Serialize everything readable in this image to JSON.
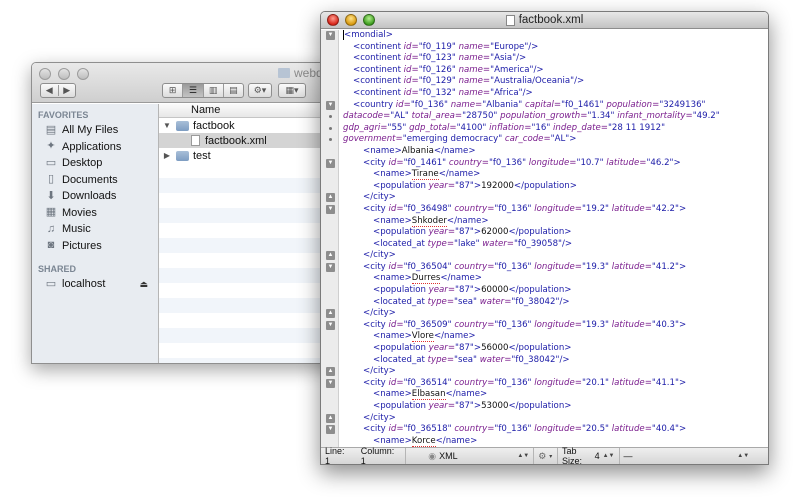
{
  "finder": {
    "title": "webdav",
    "nav": {
      "back": "◀",
      "forward": "▶"
    },
    "view_buttons": [
      "⊞",
      "☰",
      "▥",
      "▤"
    ],
    "action_button": "⚙▾",
    "arrange_button": "▦▾",
    "sidebar": {
      "favorites_header": "FAVORITES",
      "favorites": [
        {
          "label": "All My Files",
          "icon": "all-files-icon"
        },
        {
          "label": "Applications",
          "icon": "applications-icon"
        },
        {
          "label": "Desktop",
          "icon": "desktop-icon"
        },
        {
          "label": "Documents",
          "icon": "documents-icon"
        },
        {
          "label": "Downloads",
          "icon": "downloads-icon"
        },
        {
          "label": "Movies",
          "icon": "movies-icon"
        },
        {
          "label": "Music",
          "icon": "music-icon"
        },
        {
          "label": "Pictures",
          "icon": "pictures-icon"
        }
      ],
      "shared_header": "SHARED",
      "shared": [
        {
          "label": "localhost",
          "icon": "computer-icon"
        }
      ]
    },
    "column_header": "Name",
    "files": [
      {
        "name": "factbook",
        "type": "folder",
        "expanded": true
      },
      {
        "name": "factbook.xml",
        "type": "file",
        "selected": true
      },
      {
        "name": "test",
        "type": "folder",
        "expanded": false
      }
    ]
  },
  "editor": {
    "title": "factbook.xml",
    "lines": [
      {
        "i": 0,
        "parts": [
          [
            "tag",
            "<mondial>"
          ]
        ],
        "cursor": true
      },
      {
        "i": 1,
        "parts": [
          [
            "tag",
            "<continent "
          ],
          [
            "attr",
            "id="
          ],
          [
            "val",
            "\"f0_119\" "
          ],
          [
            "attr",
            "name="
          ],
          [
            "val",
            "\"Europe\""
          ],
          [
            "tag",
            "/>"
          ]
        ]
      },
      {
        "i": 1,
        "parts": [
          [
            "tag",
            "<continent "
          ],
          [
            "attr",
            "id="
          ],
          [
            "val",
            "\"f0_123\" "
          ],
          [
            "attr",
            "name="
          ],
          [
            "val",
            "\"Asia\""
          ],
          [
            "tag",
            "/>"
          ]
        ]
      },
      {
        "i": 1,
        "parts": [
          [
            "tag",
            "<continent "
          ],
          [
            "attr",
            "id="
          ],
          [
            "val",
            "\"f0_126\" "
          ],
          [
            "attr",
            "name="
          ],
          [
            "val",
            "\"America\""
          ],
          [
            "tag",
            "/>"
          ]
        ]
      },
      {
        "i": 1,
        "parts": [
          [
            "tag",
            "<continent "
          ],
          [
            "attr",
            "id="
          ],
          [
            "val",
            "\"f0_129\" "
          ],
          [
            "attr",
            "name="
          ],
          [
            "val",
            "\"Australia/Oceania\""
          ],
          [
            "tag",
            "/>"
          ]
        ]
      },
      {
        "i": 1,
        "parts": [
          [
            "tag",
            "<continent "
          ],
          [
            "attr",
            "id="
          ],
          [
            "val",
            "\"f0_132\" "
          ],
          [
            "attr",
            "name="
          ],
          [
            "val",
            "\"Africa\""
          ],
          [
            "tag",
            "/>"
          ]
        ]
      },
      {
        "i": 1,
        "parts": [
          [
            "tag",
            "<country "
          ],
          [
            "attr",
            "id="
          ],
          [
            "val",
            "\"f0_136\" "
          ],
          [
            "attr",
            "name="
          ],
          [
            "val",
            "\"Albania\" "
          ],
          [
            "attr",
            "capital="
          ],
          [
            "val",
            "\"f0_1461\" "
          ],
          [
            "attr",
            "population="
          ],
          [
            "val",
            "\"3249136\""
          ]
        ]
      },
      {
        "i": 0,
        "cont": true,
        "parts": [
          [
            "attr",
            "datacode="
          ],
          [
            "val",
            "\"AL\" "
          ],
          [
            "attr",
            "total_area="
          ],
          [
            "val",
            "\"28750\" "
          ],
          [
            "attr",
            "population_growth="
          ],
          [
            "val",
            "\"1.34\" "
          ],
          [
            "attr",
            "infant_mortality="
          ],
          [
            "val",
            "\"49.2\""
          ]
        ]
      },
      {
        "i": 0,
        "cont": true,
        "parts": [
          [
            "attr",
            "gdp_agri="
          ],
          [
            "val",
            "\"55\" "
          ],
          [
            "attr",
            "gdp_total="
          ],
          [
            "val",
            "\"4100\" "
          ],
          [
            "attr",
            "inflation="
          ],
          [
            "val",
            "\"16\" "
          ],
          [
            "attr",
            "indep_date="
          ],
          [
            "val",
            "\"28 11 1912\""
          ]
        ]
      },
      {
        "i": 0,
        "cont": true,
        "parts": [
          [
            "attr",
            "government="
          ],
          [
            "val",
            "\"emerging democracy\" "
          ],
          [
            "attr",
            "car_code="
          ],
          [
            "val",
            "\"AL\""
          ],
          [
            "tag",
            ">"
          ]
        ]
      },
      {
        "i": 2,
        "parts": [
          [
            "tag",
            "<name>"
          ],
          [
            "text",
            "Albania"
          ],
          [
            "tag",
            "</name>"
          ]
        ]
      },
      {
        "i": 2,
        "parts": [
          [
            "tag",
            "<city "
          ],
          [
            "attr",
            "id="
          ],
          [
            "val",
            "\"f0_1461\" "
          ],
          [
            "attr",
            "country="
          ],
          [
            "val",
            "\"f0_136\" "
          ],
          [
            "attr",
            "longitude="
          ],
          [
            "val",
            "\"10.7\" "
          ],
          [
            "attr",
            "latitude="
          ],
          [
            "val",
            "\"46.2\""
          ],
          [
            "tag",
            ">"
          ]
        ]
      },
      {
        "i": 3,
        "parts": [
          [
            "tag",
            "<name>"
          ],
          [
            "spell",
            "Tirane"
          ],
          [
            "tag",
            "</name>"
          ]
        ]
      },
      {
        "i": 3,
        "parts": [
          [
            "tag",
            "<population "
          ],
          [
            "attr",
            "year="
          ],
          [
            "val",
            "\"87\""
          ],
          [
            "tag",
            ">"
          ],
          [
            "text",
            "192000"
          ],
          [
            "tag",
            "</population>"
          ]
        ]
      },
      {
        "i": 2,
        "parts": [
          [
            "tag",
            "</city>"
          ]
        ]
      },
      {
        "i": 2,
        "parts": [
          [
            "tag",
            "<city "
          ],
          [
            "attr",
            "id="
          ],
          [
            "val",
            "\"f0_36498\" "
          ],
          [
            "attr",
            "country="
          ],
          [
            "val",
            "\"f0_136\" "
          ],
          [
            "attr",
            "longitude="
          ],
          [
            "val",
            "\"19.2\" "
          ],
          [
            "attr",
            "latitude="
          ],
          [
            "val",
            "\"42.2\""
          ],
          [
            "tag",
            ">"
          ]
        ]
      },
      {
        "i": 3,
        "parts": [
          [
            "tag",
            "<name>"
          ],
          [
            "spell",
            "Shkoder"
          ],
          [
            "tag",
            "</name>"
          ]
        ]
      },
      {
        "i": 3,
        "parts": [
          [
            "tag",
            "<population "
          ],
          [
            "attr",
            "year="
          ],
          [
            "val",
            "\"87\""
          ],
          [
            "tag",
            ">"
          ],
          [
            "text",
            "62000"
          ],
          [
            "tag",
            "</population>"
          ]
        ]
      },
      {
        "i": 3,
        "parts": [
          [
            "tag",
            "<located_at "
          ],
          [
            "attr",
            "type="
          ],
          [
            "val",
            "\"lake\" "
          ],
          [
            "attr",
            "water="
          ],
          [
            "val",
            "\"f0_39058\""
          ],
          [
            "tag",
            "/>"
          ]
        ]
      },
      {
        "i": 2,
        "parts": [
          [
            "tag",
            "</city>"
          ]
        ]
      },
      {
        "i": 2,
        "parts": [
          [
            "tag",
            "<city "
          ],
          [
            "attr",
            "id="
          ],
          [
            "val",
            "\"f0_36504\" "
          ],
          [
            "attr",
            "country="
          ],
          [
            "val",
            "\"f0_136\" "
          ],
          [
            "attr",
            "longitude="
          ],
          [
            "val",
            "\"19.3\" "
          ],
          [
            "attr",
            "latitude="
          ],
          [
            "val",
            "\"41.2\""
          ],
          [
            "tag",
            ">"
          ]
        ]
      },
      {
        "i": 3,
        "parts": [
          [
            "tag",
            "<name>"
          ],
          [
            "spell",
            "Durres"
          ],
          [
            "tag",
            "</name>"
          ]
        ]
      },
      {
        "i": 3,
        "parts": [
          [
            "tag",
            "<population "
          ],
          [
            "attr",
            "year="
          ],
          [
            "val",
            "\"87\""
          ],
          [
            "tag",
            ">"
          ],
          [
            "text",
            "60000"
          ],
          [
            "tag",
            "</population>"
          ]
        ]
      },
      {
        "i": 3,
        "parts": [
          [
            "tag",
            "<located_at "
          ],
          [
            "attr",
            "type="
          ],
          [
            "val",
            "\"sea\" "
          ],
          [
            "attr",
            "water="
          ],
          [
            "val",
            "\"f0_38042\""
          ],
          [
            "tag",
            "/>"
          ]
        ]
      },
      {
        "i": 2,
        "parts": [
          [
            "tag",
            "</city>"
          ]
        ]
      },
      {
        "i": 2,
        "parts": [
          [
            "tag",
            "<city "
          ],
          [
            "attr",
            "id="
          ],
          [
            "val",
            "\"f0_36509\" "
          ],
          [
            "attr",
            "country="
          ],
          [
            "val",
            "\"f0_136\" "
          ],
          [
            "attr",
            "longitude="
          ],
          [
            "val",
            "\"19.3\" "
          ],
          [
            "attr",
            "latitude="
          ],
          [
            "val",
            "\"40.3\""
          ],
          [
            "tag",
            ">"
          ]
        ]
      },
      {
        "i": 3,
        "parts": [
          [
            "tag",
            "<name>"
          ],
          [
            "spell",
            "Vlore"
          ],
          [
            "tag",
            "</name>"
          ]
        ]
      },
      {
        "i": 3,
        "parts": [
          [
            "tag",
            "<population "
          ],
          [
            "attr",
            "year="
          ],
          [
            "val",
            "\"87\""
          ],
          [
            "tag",
            ">"
          ],
          [
            "text",
            "56000"
          ],
          [
            "tag",
            "</population>"
          ]
        ]
      },
      {
        "i": 3,
        "parts": [
          [
            "tag",
            "<located_at "
          ],
          [
            "attr",
            "type="
          ],
          [
            "val",
            "\"sea\" "
          ],
          [
            "attr",
            "water="
          ],
          [
            "val",
            "\"f0_38042\""
          ],
          [
            "tag",
            "/>"
          ]
        ]
      },
      {
        "i": 2,
        "parts": [
          [
            "tag",
            "</city>"
          ]
        ]
      },
      {
        "i": 2,
        "parts": [
          [
            "tag",
            "<city "
          ],
          [
            "attr",
            "id="
          ],
          [
            "val",
            "\"f0_36514\" "
          ],
          [
            "attr",
            "country="
          ],
          [
            "val",
            "\"f0_136\" "
          ],
          [
            "attr",
            "longitude="
          ],
          [
            "val",
            "\"20.1\" "
          ],
          [
            "attr",
            "latitude="
          ],
          [
            "val",
            "\"41.1\""
          ],
          [
            "tag",
            ">"
          ]
        ]
      },
      {
        "i": 3,
        "parts": [
          [
            "tag",
            "<name>"
          ],
          [
            "spell",
            "Elbasan"
          ],
          [
            "tag",
            "</name>"
          ]
        ]
      },
      {
        "i": 3,
        "parts": [
          [
            "tag",
            "<population "
          ],
          [
            "attr",
            "year="
          ],
          [
            "val",
            "\"87\""
          ],
          [
            "tag",
            ">"
          ],
          [
            "text",
            "53000"
          ],
          [
            "tag",
            "</population>"
          ]
        ]
      },
      {
        "i": 2,
        "parts": [
          [
            "tag",
            "</city>"
          ]
        ]
      },
      {
        "i": 2,
        "parts": [
          [
            "tag",
            "<city "
          ],
          [
            "attr",
            "id="
          ],
          [
            "val",
            "\"f0_36518\" "
          ],
          [
            "attr",
            "country="
          ],
          [
            "val",
            "\"f0_136\" "
          ],
          [
            "attr",
            "longitude="
          ],
          [
            "val",
            "\"20.5\" "
          ],
          [
            "attr",
            "latitude="
          ],
          [
            "val",
            "\"40.4\""
          ],
          [
            "tag",
            ">"
          ]
        ]
      },
      {
        "i": 3,
        "parts": [
          [
            "tag",
            "<name>"
          ],
          [
            "spell",
            "Korce"
          ],
          [
            "tag",
            "</name>"
          ]
        ]
      }
    ],
    "status": {
      "line": "Line: 1",
      "column": "Column: 1",
      "language": "XML",
      "tab_size_label": "Tab Size:",
      "tab_size": "4",
      "symbol": "—"
    }
  }
}
